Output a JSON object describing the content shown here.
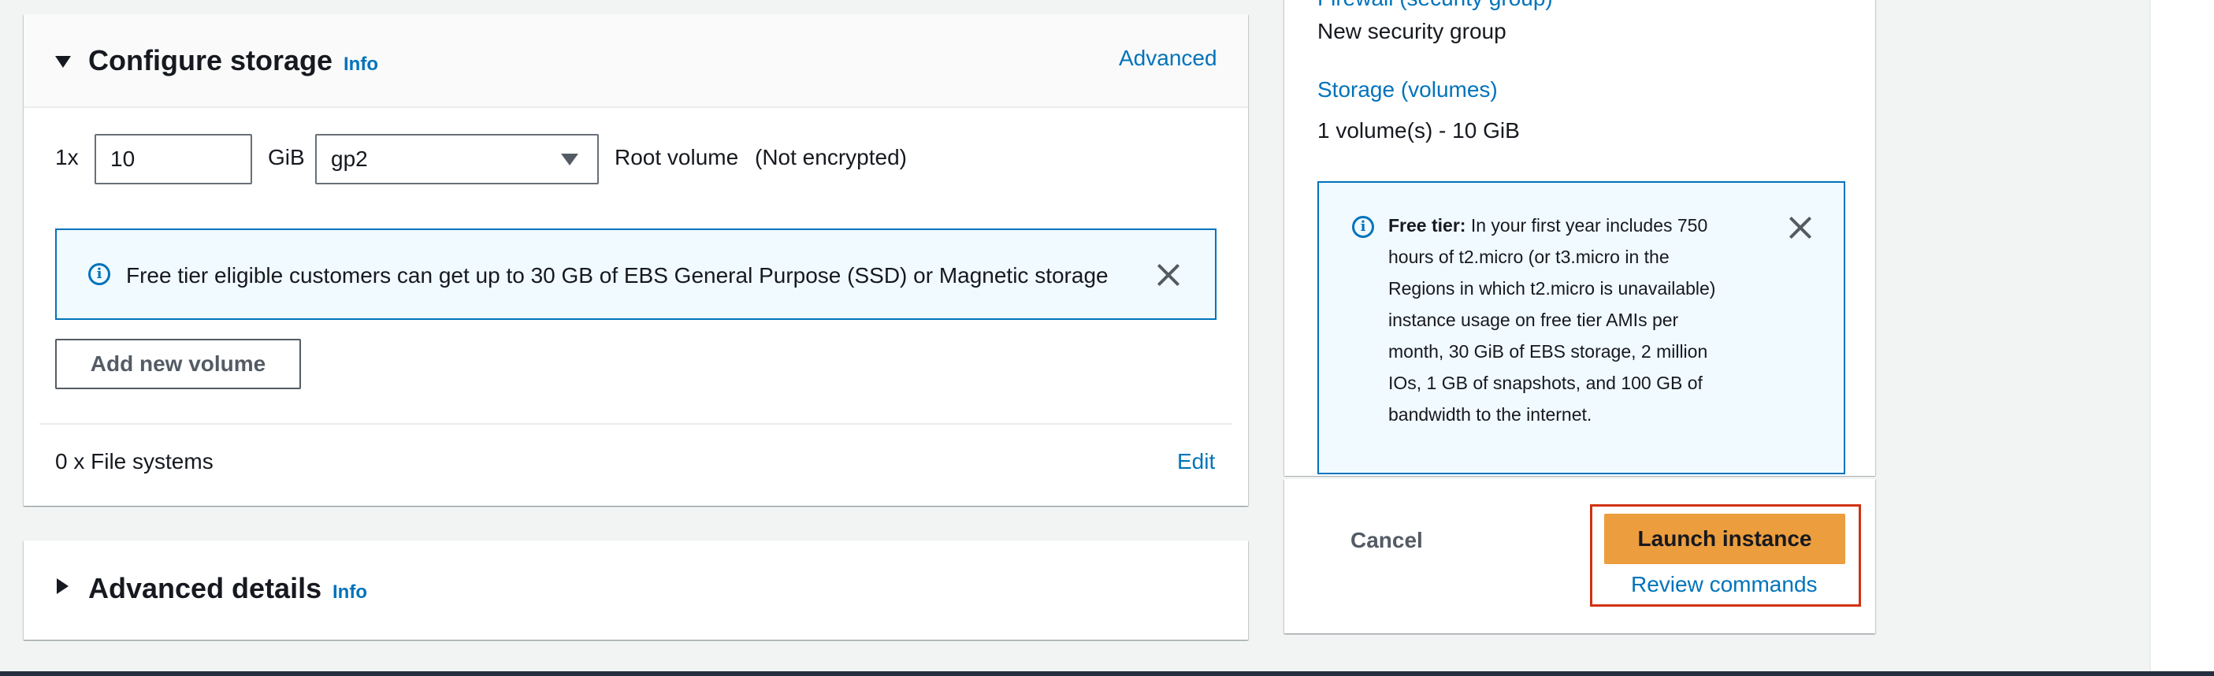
{
  "configure_storage": {
    "title": "Configure storage",
    "info": "Info",
    "advanced_link": "Advanced",
    "volume_row": {
      "count_label": "1x",
      "size_value": "10",
      "size_unit": "GiB",
      "volume_type": "gp2",
      "root_label": "Root volume",
      "encryption_label": "(Not encrypted)"
    },
    "free_tier_alert": "Free tier eligible customers can get up to 30 GB of EBS General Purpose (SSD) or Magnetic storage",
    "add_volume_button": "Add new volume",
    "file_systems_label": "0 x File systems",
    "edit_link": "Edit"
  },
  "advanced_details": {
    "title": "Advanced details",
    "info": "Info"
  },
  "summary": {
    "firewall_label": "Firewall (security group)",
    "firewall_value": "New security group",
    "storage_label": "Storage (volumes)",
    "storage_value": "1 volume(s) - 10 GiB",
    "free_tier": {
      "bold": "Free tier:",
      "line1": "In your first year includes 750",
      "line2": "hours of t2.micro (or t3.micro in the",
      "line3": "Regions in which t2.micro is unavailable)",
      "line4": "instance usage on free tier AMIs per",
      "line5": "month, 30 GiB of EBS storage, 2 million",
      "line6": "IOs, 1 GB of snapshots, and 100 GB of",
      "line7": "bandwidth to the internet."
    },
    "cancel_button": "Cancel",
    "launch_button": "Launch instance",
    "review_link": "Review commands"
  },
  "colors": {
    "link": "#0073bb",
    "primary_button": "#ec9d3d",
    "highlight": "#d13212",
    "alert_bg": "#f1faff"
  }
}
